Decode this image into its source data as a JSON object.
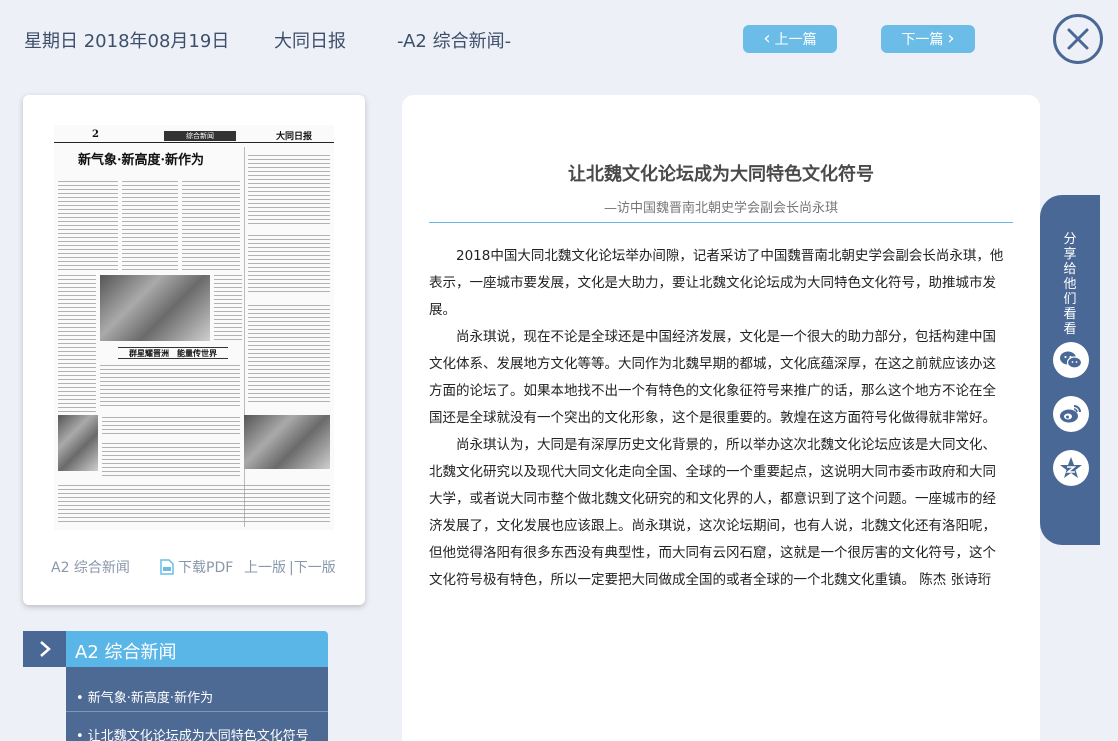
{
  "header": {
    "date": "星期日 2018年08月19日",
    "paper_name": "大同日报",
    "section": "-A2 综合新闻-",
    "prev_label": "上一篇",
    "next_label": "下一篇"
  },
  "paper_card": {
    "thumb": {
      "page_number": "2",
      "section_tag": "综合新闻",
      "logo": "大同日报",
      "headline": "新气象·新高度·新作为",
      "band_title": "群星耀晋洲　能量传世界"
    },
    "footer_section": "A2 综合新闻",
    "download_pdf": "下载PDF",
    "prev_page": "上一版",
    "next_page": "|下一版"
  },
  "section_menu": {
    "title": "A2  综合新闻",
    "items": [
      "• 新气象·新高度·新作为",
      "• 让北魏文化论坛成为大同特色文化符号"
    ]
  },
  "article": {
    "title": "让北魏文化论坛成为大同特色文化符号",
    "subtitle": "—访中国魏晋南北朝史学会副会长尚永琪",
    "paragraphs": [
      "2018中国大同北魏文化论坛举办间隙，记者采访了中国魏晋南北朝史学会副会长尚永琪，他表示，一座城市要发展，文化是大助力，要让北魏文化论坛成为大同特色文化符号，助推城市发展。",
      "尚永琪说，现在不论是全球还是中国经济发展，文化是一个很大的助力部分，包括构建中国文化体系、发展地方文化等等。大同作为北魏早期的都城，文化底蕴深厚，在这之前就应该办这方面的论坛了。如果本地找不出一个有特色的文化象征符号来推广的话，那么这个地方不论在全国还是全球就没有一个突出的文化形象，这个是很重要的。敦煌在这方面符号化做得就非常好。",
      "尚永琪认为，大同是有深厚历史文化背景的，所以举办这次北魏文化论坛应该是大同文化、北魏文化研究以及现代大同文化走向全国、全球的一个重要起点，这说明大同市委市政府和大同大学，或者说大同市整个做北魏文化研究的和文化界的人，都意识到了这个问题。一座城市的经济发展了，文化发展也应该跟上。尚永琪说，这次论坛期间，也有人说，北魏文化还有洛阳呢，但他觉得洛阳有很多东西没有典型性，而大同有云冈石窟，这就是一个很厉害的文化符号，这个文化符号极有特色，所以一定要把大同做成全国的或者全球的一个北魏文化重镇。 陈杰 张诗珩"
    ]
  },
  "share": {
    "label": "分享给他们看看",
    "icons": [
      "wechat-icon",
      "weibo-icon",
      "qzone-icon"
    ]
  },
  "colors": {
    "accent": "#6bbde8",
    "navy": "#4a6896",
    "background": "#edf1f7"
  }
}
